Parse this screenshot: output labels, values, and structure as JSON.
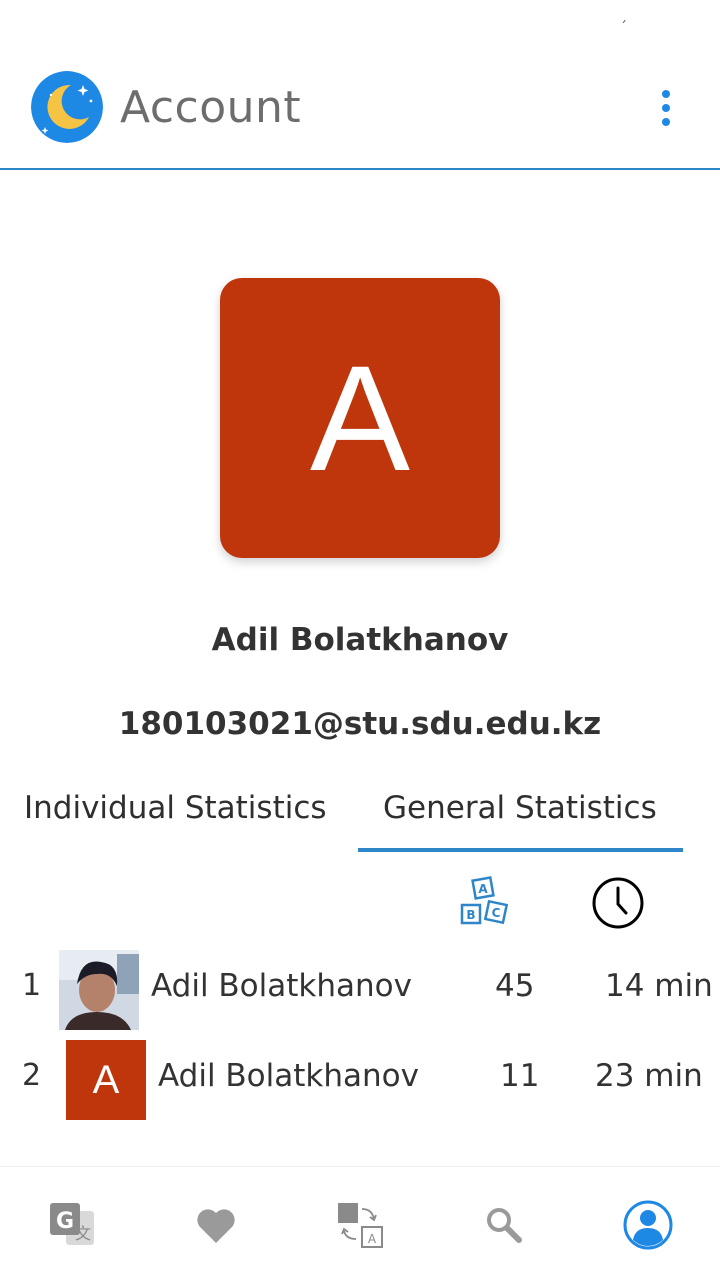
{
  "app_bar": {
    "title": "Account"
  },
  "profile": {
    "initial": "A",
    "name": "Adil Bolatkhanov",
    "email": "180103021@stu.sdu.edu.kz",
    "avatar_color": "#bf360c"
  },
  "tabs": [
    {
      "label": "Individual Statistics",
      "active": false
    },
    {
      "label": "General Statistics",
      "active": true
    }
  ],
  "columns": {
    "words_icon": "abc-blocks-icon",
    "time_icon": "clock-icon"
  },
  "leaderboard": [
    {
      "rank": "1",
      "name": "Adil Bolatkhanov",
      "words": "45",
      "time": "14 min",
      "avatar": "photo"
    },
    {
      "rank": "2",
      "name": "Adil Bolatkhanov",
      "words": "11",
      "time": "23 min",
      "avatar": "initial",
      "initial": "A"
    }
  ],
  "bottom_nav": [
    {
      "icon": "translate-icon",
      "active": false
    },
    {
      "icon": "heart-icon",
      "active": false
    },
    {
      "icon": "flashcards-icon",
      "active": false
    },
    {
      "icon": "search-icon",
      "active": false
    },
    {
      "icon": "account-icon",
      "active": true
    }
  ],
  "colors": {
    "accent": "#2e86c9",
    "avatar": "#bf360c",
    "logo_bg": "#1e88e5",
    "moon": "#f6c445"
  }
}
